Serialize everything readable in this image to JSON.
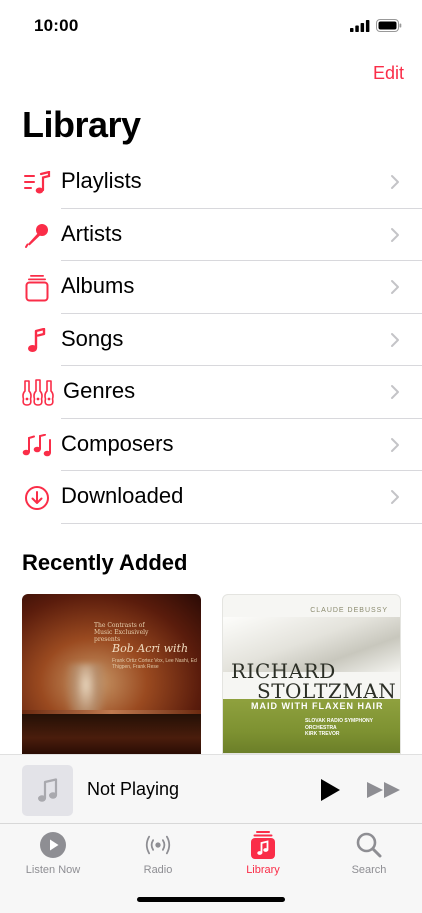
{
  "status_bar": {
    "time": "10:00"
  },
  "nav": {
    "edit_label": "Edit"
  },
  "page": {
    "title": "Library"
  },
  "library_items": [
    {
      "label": "Playlists",
      "icon": "playlists-icon"
    },
    {
      "label": "Artists",
      "icon": "microphone-icon"
    },
    {
      "label": "Albums",
      "icon": "albums-icon"
    },
    {
      "label": "Songs",
      "icon": "music-note-icon"
    },
    {
      "label": "Genres",
      "icon": "guitars-icon"
    },
    {
      "label": "Composers",
      "icon": "composers-icon"
    },
    {
      "label": "Downloaded",
      "icon": "download-icon"
    }
  ],
  "recently_added": {
    "title": "Recently Added",
    "albums": [
      {
        "cover_header": "The Contrasts of Music Exclusively presents",
        "cover_title": "Bob Acri with",
        "cover_subtitle": "Frank Ortiz Cortez Vox, Lee Nashi, Ed Thigpen, Frank Rese"
      },
      {
        "cover_header": "CLAUDE DEBUSSY",
        "cover_title_line1": "RICHARD",
        "cover_title_line2": "STOLTZMAN",
        "cover_subtitle": "MAID WITH FLAXEN HAIR",
        "cover_credits_line1": "SLOVAK RADIO SYMPHONY ORCHESTRA",
        "cover_credits_line2": "KIRK TREVOR"
      }
    ]
  },
  "mini_player": {
    "title": "Not Playing"
  },
  "tab_bar": {
    "tabs": [
      {
        "label": "Listen Now",
        "icon": "play-circle-icon"
      },
      {
        "label": "Radio",
        "icon": "radio-icon"
      },
      {
        "label": "Library",
        "icon": "library-icon"
      },
      {
        "label": "Search",
        "icon": "search-icon"
      }
    ]
  },
  "colors": {
    "accent": "#fa2d48",
    "inactive": "#8e8e93"
  }
}
